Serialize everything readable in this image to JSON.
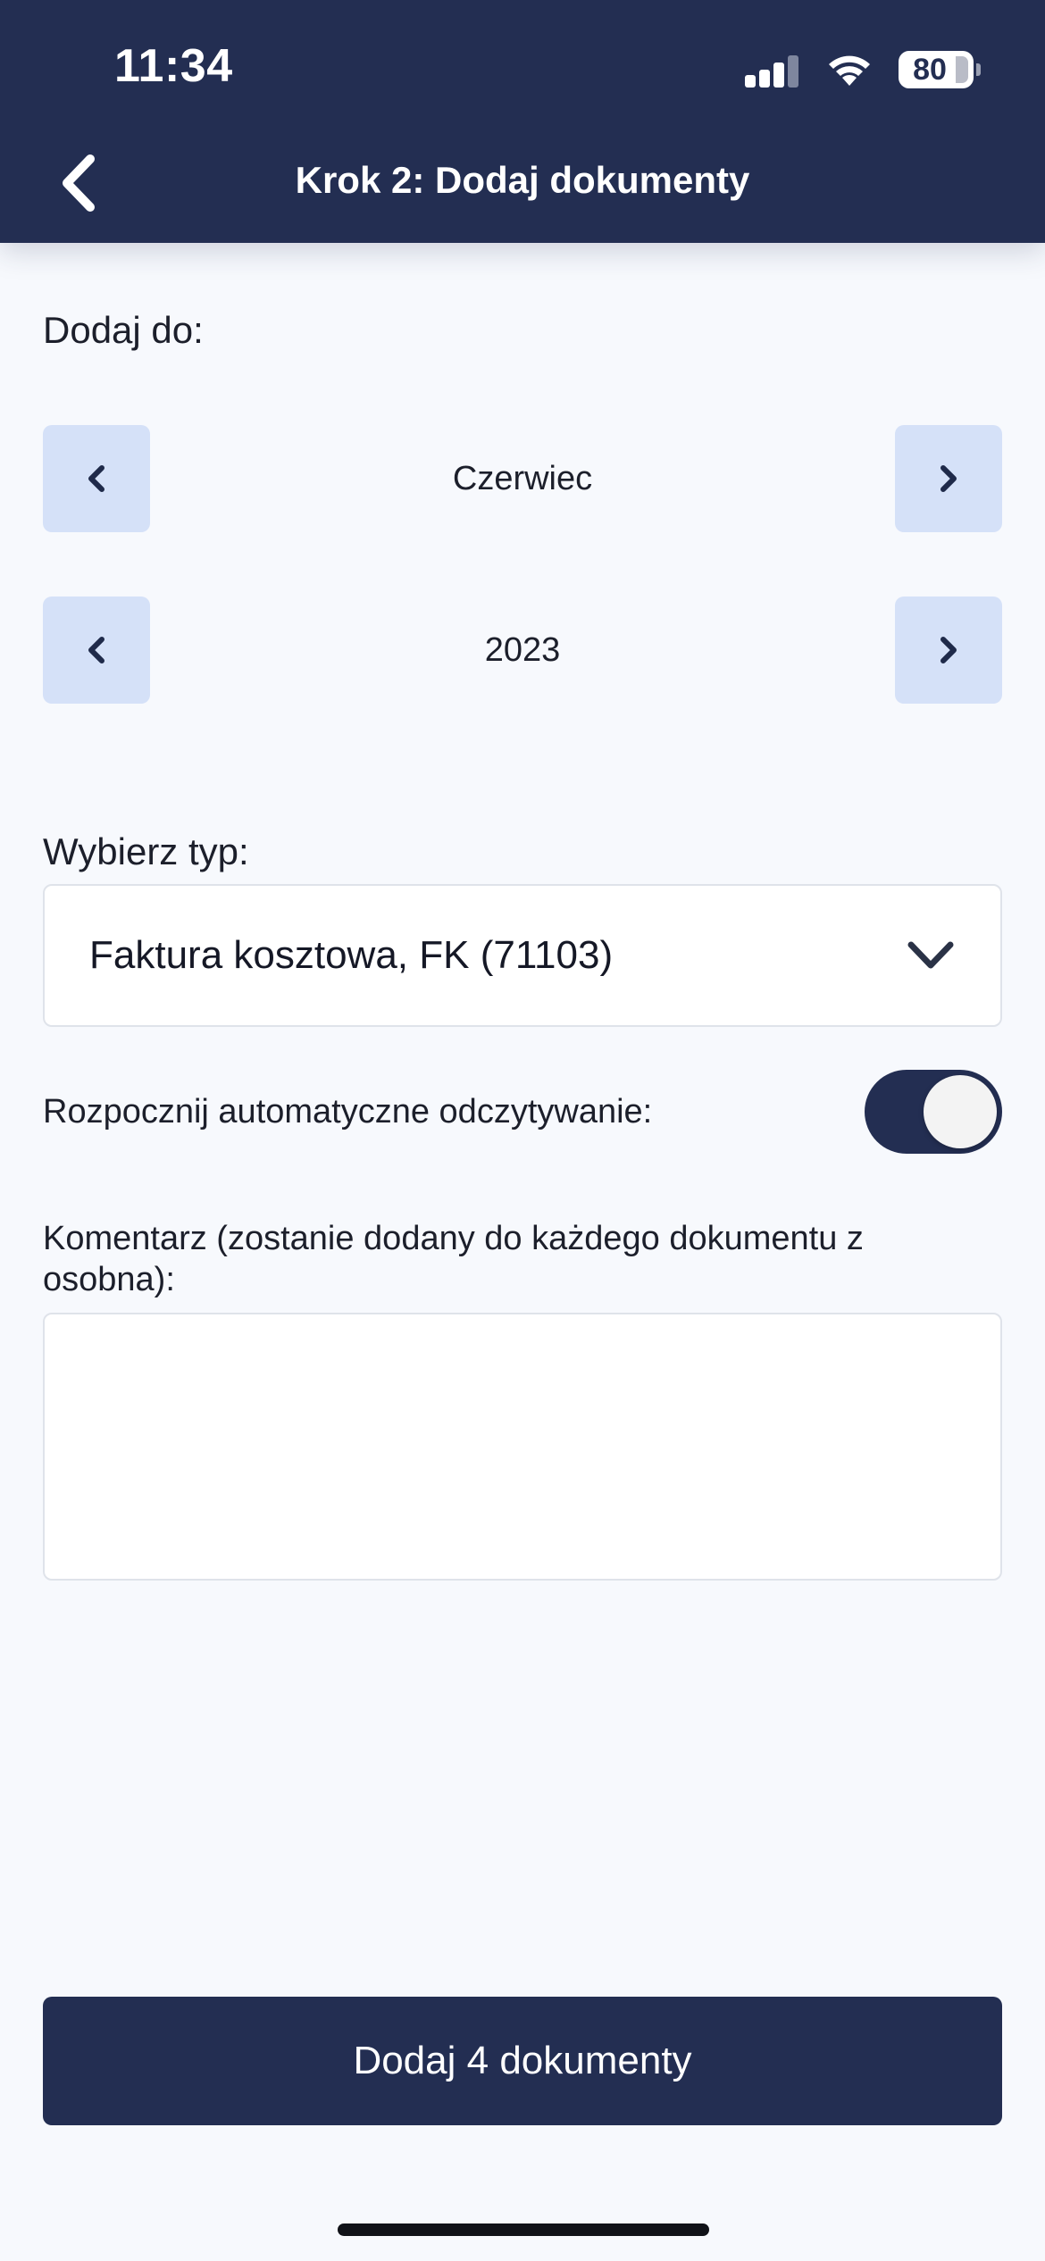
{
  "status_bar": {
    "time": "11:34",
    "battery": "80"
  },
  "header": {
    "title": "Krok 2: Dodaj dokumenty",
    "back_icon": "chevron-left-icon",
    "background_color": "#232e52"
  },
  "add_to": {
    "label": "Dodaj do:",
    "month": "Czerwiec",
    "year": "2023",
    "prev_icon": "chevron-left-icon",
    "next_icon": "chevron-right-icon"
  },
  "type_select": {
    "label": "Wybierz typ:",
    "selected": "Faktura kosztowa, FK (71103)",
    "arrow_icon": "chevron-down-icon"
  },
  "auto_read": {
    "label": "Rozpocznij automatyczne odczytywanie:",
    "enabled": true
  },
  "comment": {
    "label": "Komentarz (zostanie dodany do każdego dokumentu z osobna):",
    "value": ""
  },
  "submit": {
    "label": "Dodaj 4 dokumenty"
  },
  "colors": {
    "accent": "#232e52",
    "stepper_button": "#d5e1f8",
    "background": "#f7f9fd"
  }
}
